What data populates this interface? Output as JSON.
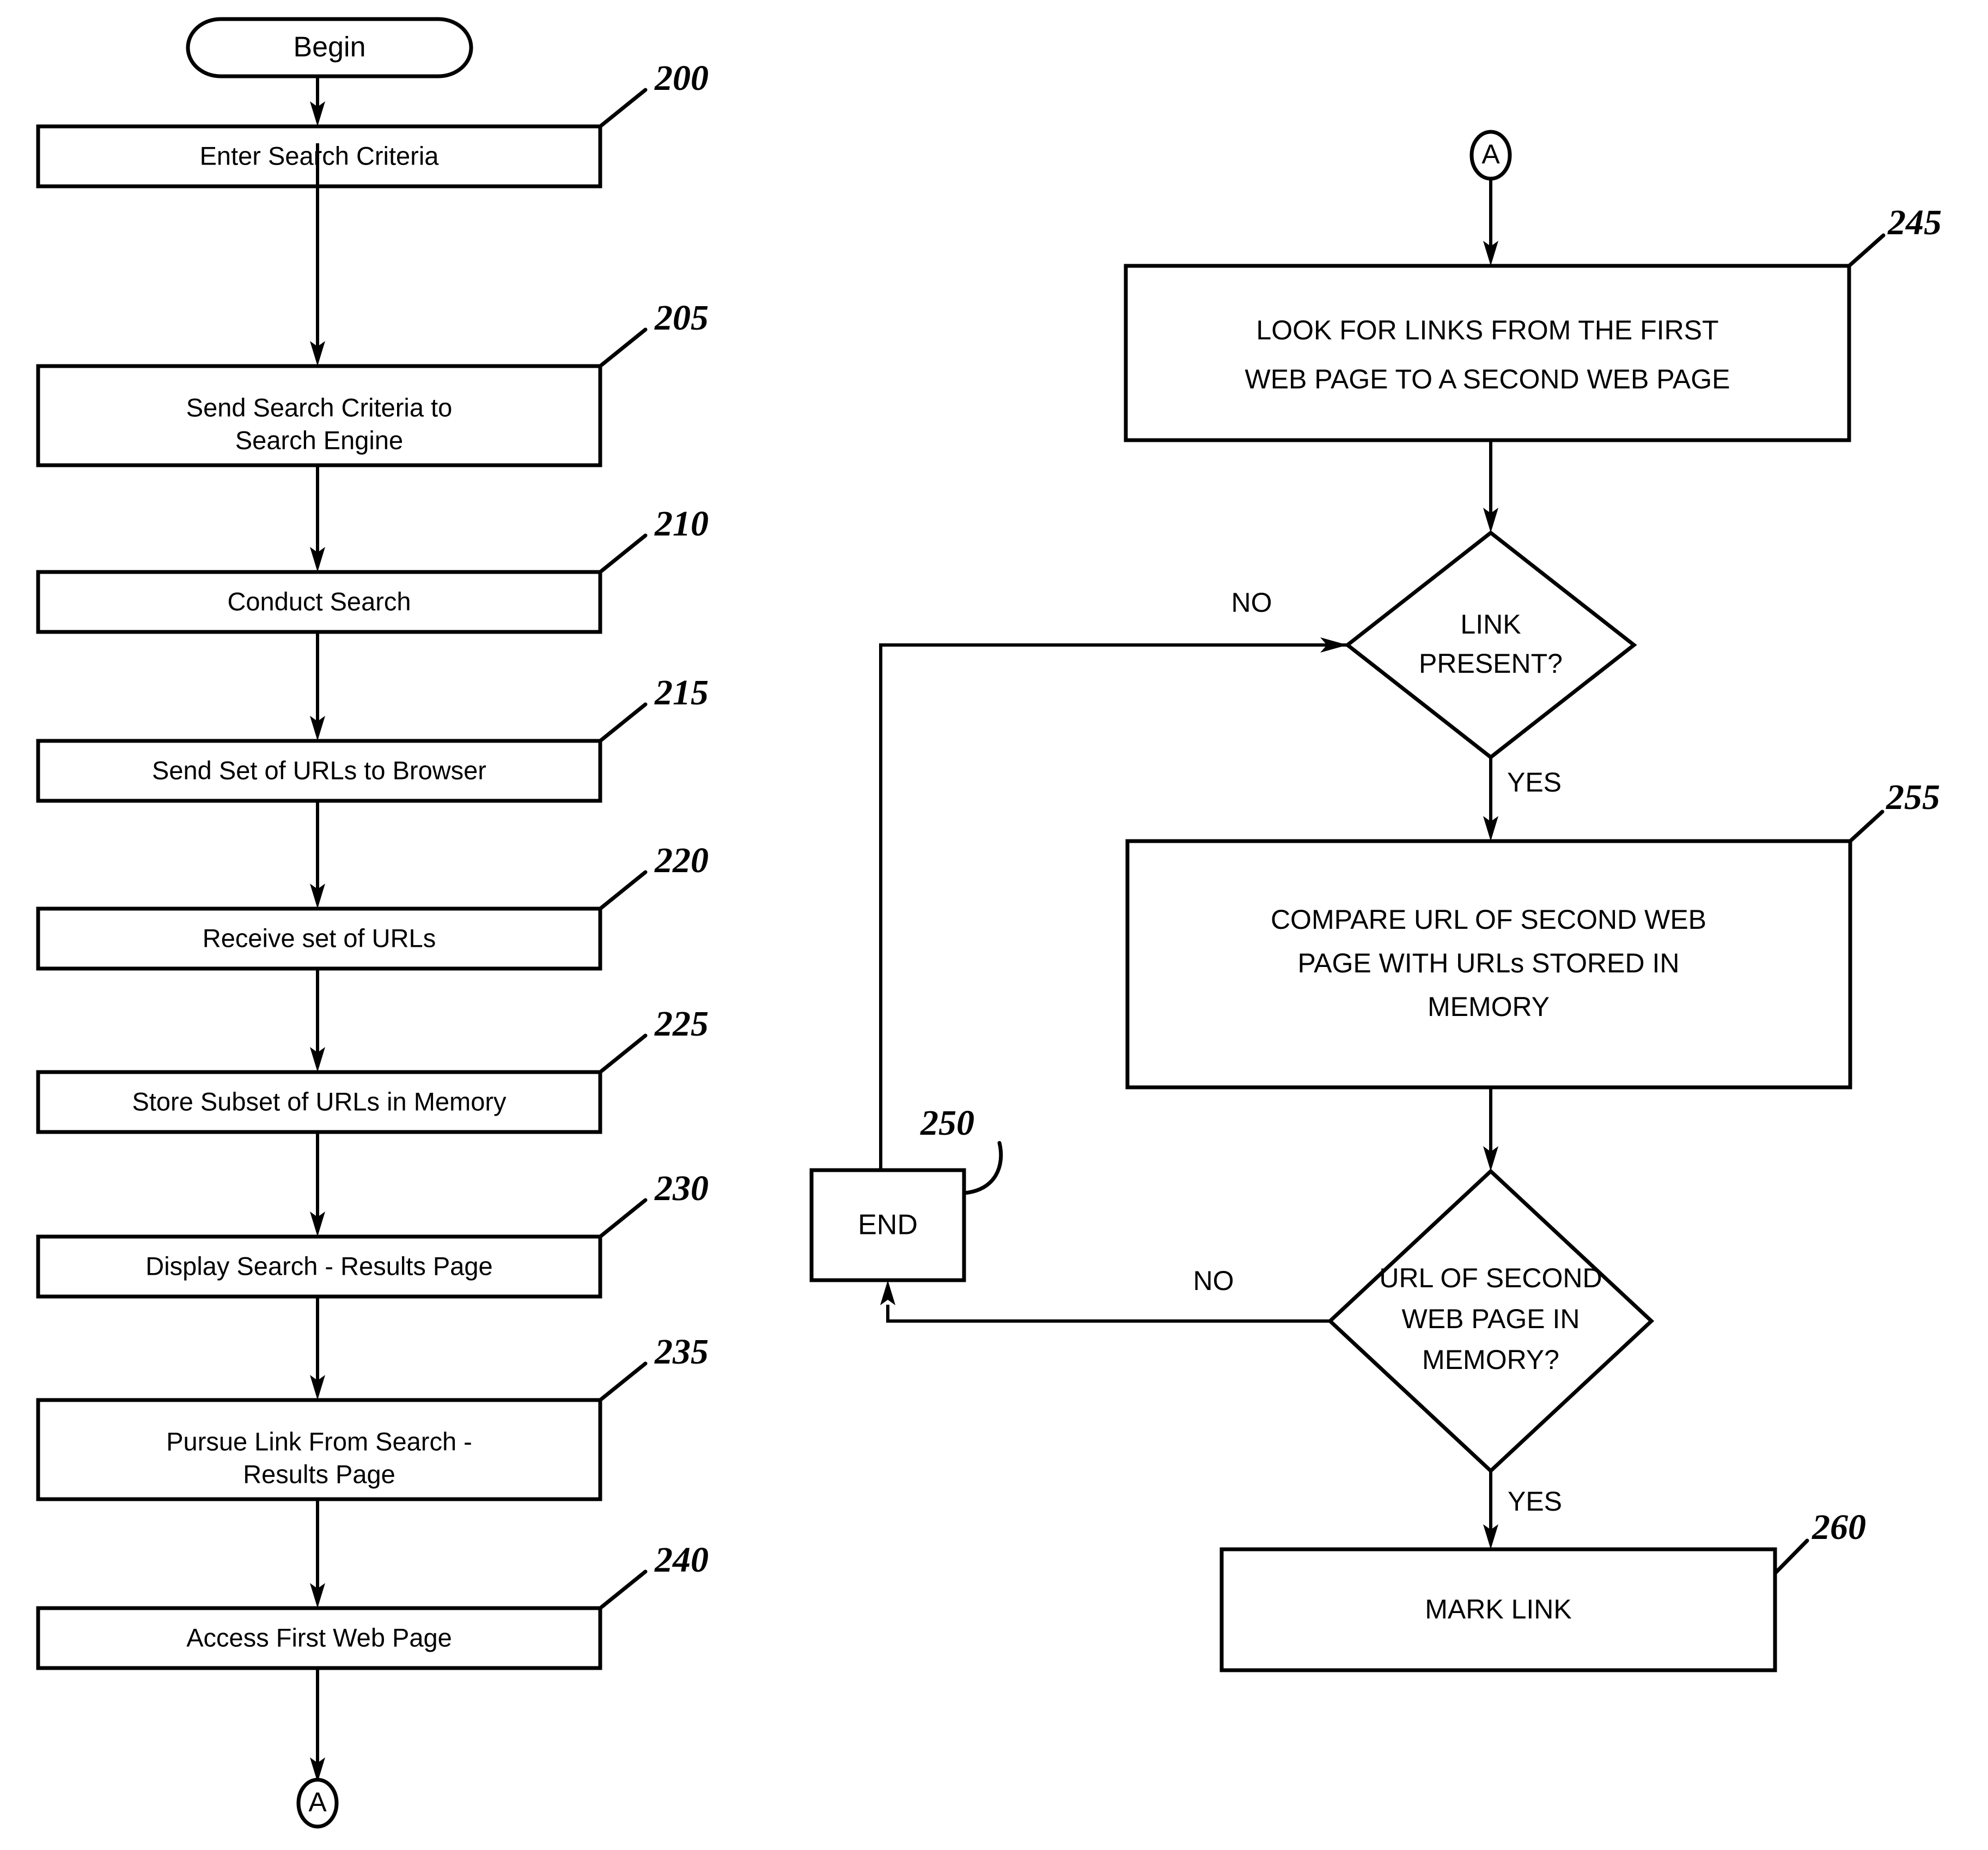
{
  "figure": {
    "type": "flowchart",
    "orientation": "two-column",
    "background_color": "#ffffff",
    "line_color": "#000000"
  },
  "left_column": {
    "terminal_begin": {
      "label": "Begin",
      "shape": "stadium"
    },
    "steps": [
      {
        "ref": "200",
        "label_line1": "Enter Search Criteria",
        "label_line2": ""
      },
      {
        "ref": "205",
        "label_line1": "Send Search Criteria to",
        "label_line2": "Search Engine"
      },
      {
        "ref": "210",
        "label_line1": "Conduct Search",
        "label_line2": ""
      },
      {
        "ref": "215",
        "label_line1": "Send Set of URLs to Browser",
        "label_line2": ""
      },
      {
        "ref": "220",
        "label_line1": "Receive set of URLs",
        "label_line2": ""
      },
      {
        "ref": "225",
        "label_line1": "Store Subset of URLs in Memory",
        "label_line2": ""
      },
      {
        "ref": "230",
        "label_line1": "Display Search - Results Page",
        "label_line2": ""
      },
      {
        "ref": "235",
        "label_line1": "Pursue Link From Search -",
        "label_line2": "Results Page"
      },
      {
        "ref": "240",
        "label_line1": "Access First Web Page",
        "label_line2": ""
      }
    ],
    "offpage_connector_out": {
      "label": "A",
      "shape": "circle"
    }
  },
  "right_column": {
    "offpage_connector_in": {
      "label": "A",
      "shape": "circle"
    },
    "process_245": {
      "ref": "245",
      "label_line1": "LOOK FOR LINKS FROM THE FIRST",
      "label_line2": "WEB PAGE TO A SECOND WEB PAGE"
    },
    "decision_link_present": {
      "label_line1": "LINK",
      "label_line2": "PRESENT?",
      "branch_no": "NO",
      "branch_yes": "YES"
    },
    "process_255": {
      "ref": "255",
      "label_line1": "COMPARE URL OF SECOND WEB",
      "label_line2": "PAGE WITH URLs STORED IN",
      "label_line3": "MEMORY"
    },
    "decision_url_in_memory": {
      "label_line1": "URL OF SECOND",
      "label_line2": "WEB PAGE IN",
      "label_line3": "MEMORY?",
      "branch_no": "NO",
      "branch_yes": "YES"
    },
    "terminal_end": {
      "ref": "250",
      "label": "END"
    },
    "process_260": {
      "ref": "260",
      "label": "MARK LINK"
    }
  }
}
